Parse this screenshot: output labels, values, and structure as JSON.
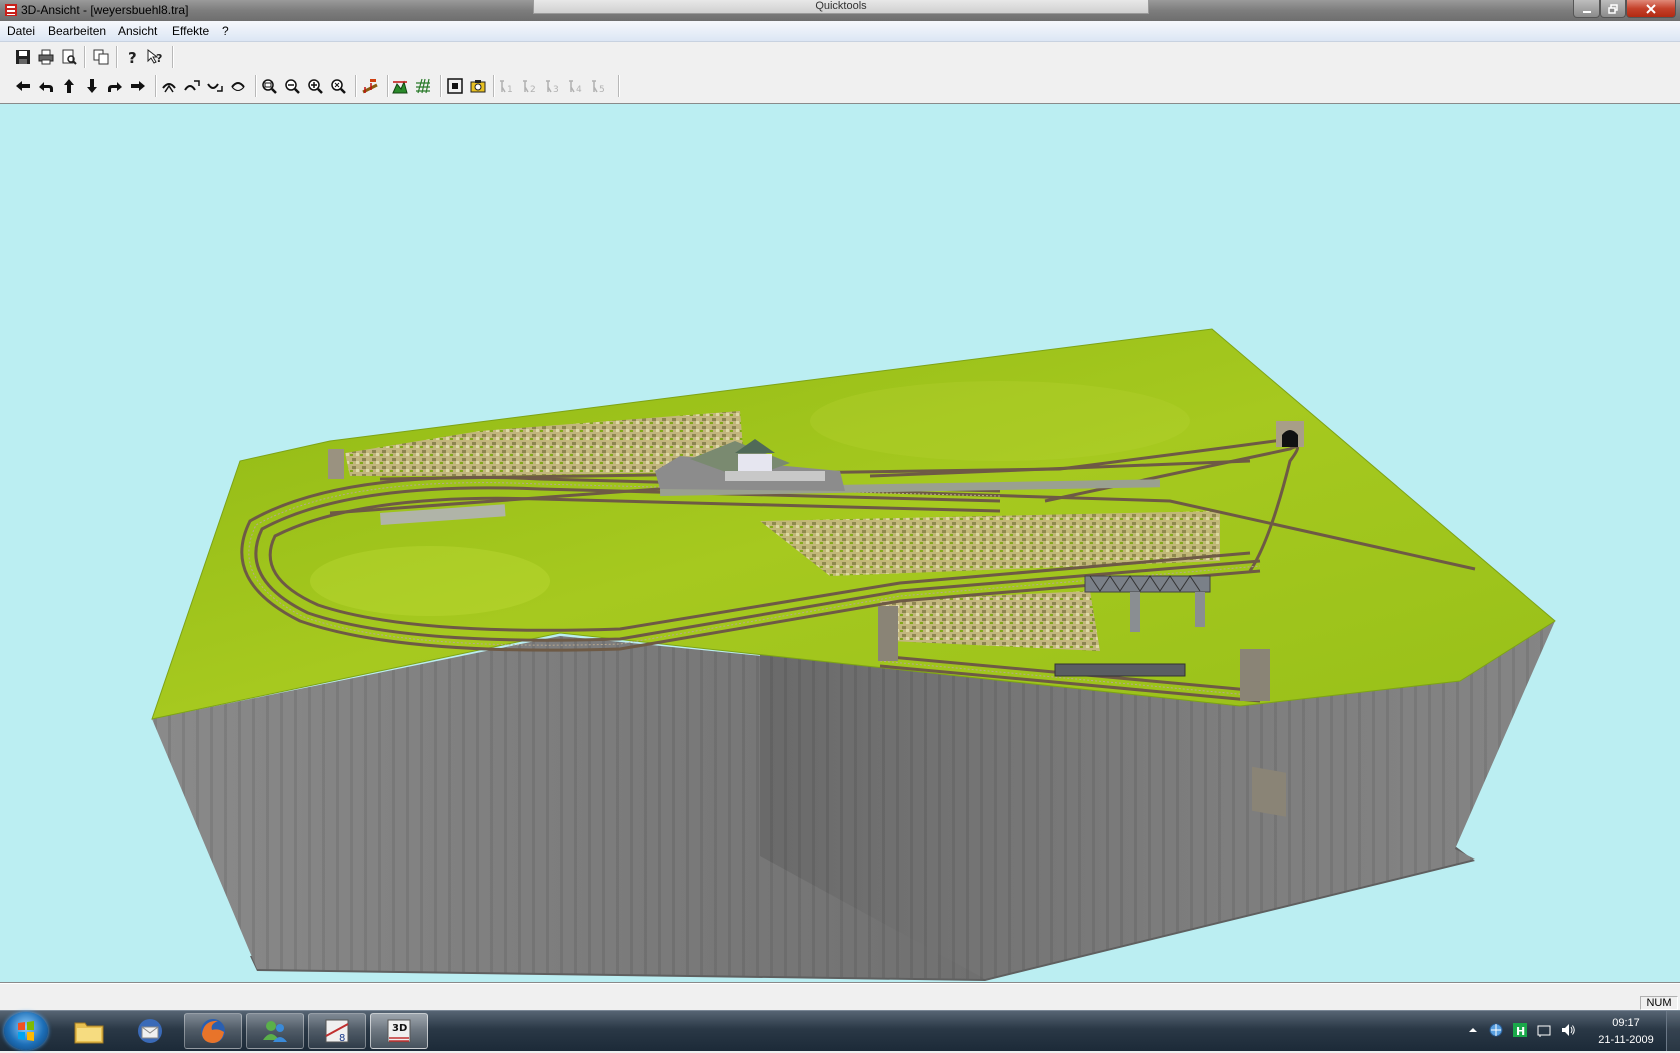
{
  "window": {
    "title": "3D-Ansicht - [weyersbuehl8.tra]",
    "quicktools": "Quicktools",
    "controls": {
      "minimize": "minimize-icon",
      "maximize": "restore-icon",
      "close": "close-icon"
    }
  },
  "menu": {
    "items": [
      {
        "label": "Datei"
      },
      {
        "label": "Bearbeiten"
      },
      {
        "label": "Ansicht"
      },
      {
        "label": "Effekte"
      },
      {
        "label": "?"
      }
    ]
  },
  "toolbar1": {
    "icons": [
      "save-icon",
      "print-icon",
      "print-preview-icon",
      "copy-icon",
      "help-icon",
      "context-help-icon"
    ]
  },
  "toolbar2": {
    "icons": [
      "arrow-left-icon",
      "rotate-left-icon",
      "arrow-up-icon",
      "arrow-down-icon",
      "rotate-right-icon",
      "arrow-right-icon",
      "tilt-icon-1",
      "tilt-icon-2",
      "tilt-icon-3",
      "tilt-icon-4",
      "zoom-window-icon",
      "zoom-out-icon",
      "zoom-in-icon",
      "zoom-all-icon",
      "track-edit-icon",
      "terrain-icon",
      "grid-icon",
      "fit-view-icon",
      "camera-icon"
    ],
    "camera_slots": [
      "1",
      "2",
      "3",
      "4",
      "5"
    ],
    "camera_slots_enabled": false
  },
  "viewport": {
    "background": "#bbeef2",
    "terrain_color": "#9cc21a",
    "wall_color": "#7a7a7a"
  },
  "statusbar": {
    "num": "NUM"
  },
  "taskbar": {
    "apps": [
      "explorer-icon",
      "thunderbird-icon",
      "firefox-icon",
      "messenger-icon",
      "wintrack-icon",
      "wintrack-3d-icon"
    ],
    "tray": [
      "arrow-up-icon",
      "network-icon",
      "h-icon",
      "flag-icon",
      "volume-icon"
    ],
    "time": "09:17",
    "date": "21-11-2009"
  }
}
